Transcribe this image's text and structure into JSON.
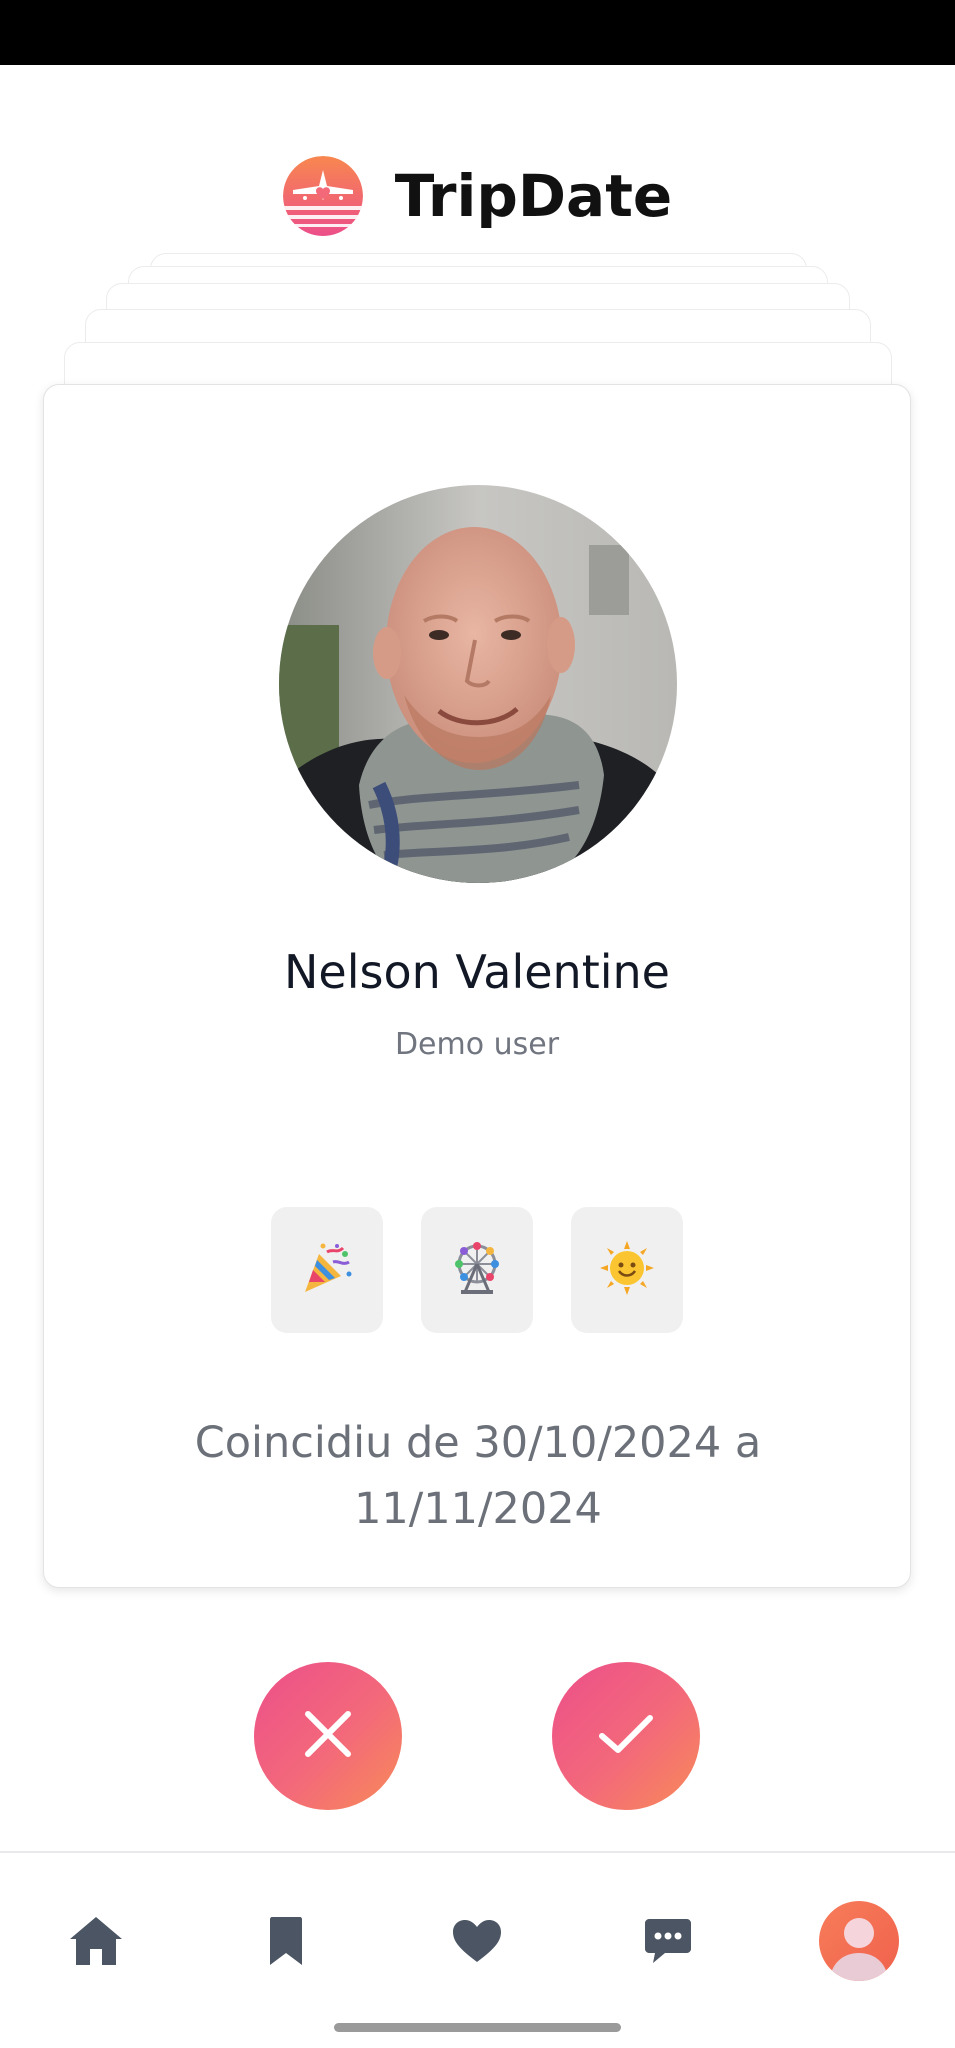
{
  "app": {
    "title": "TripDate"
  },
  "profile": {
    "name": "Nelson Valentine",
    "role": "Demo user",
    "interests": [
      {
        "icon": "party-popper-icon",
        "emoji": "🎉"
      },
      {
        "icon": "ferris-wheel-icon",
        "emoji": "🎡"
      },
      {
        "icon": "sun-icon",
        "emoji": "🌞"
      }
    ],
    "coincidence_text": "Coincidiu de 30/10/2024 a 11/11/2024"
  },
  "actions": {
    "reject": "close-icon",
    "accept": "check-icon"
  },
  "nav": {
    "items": [
      "home-icon",
      "bookmark-icon",
      "heart-icon",
      "chat-icon",
      "profile-avatar"
    ]
  },
  "colors": {
    "accent_start": "#ec4f8a",
    "accent_end": "#f88b57",
    "nav_icon": "#4b5563",
    "title": "#111111"
  }
}
